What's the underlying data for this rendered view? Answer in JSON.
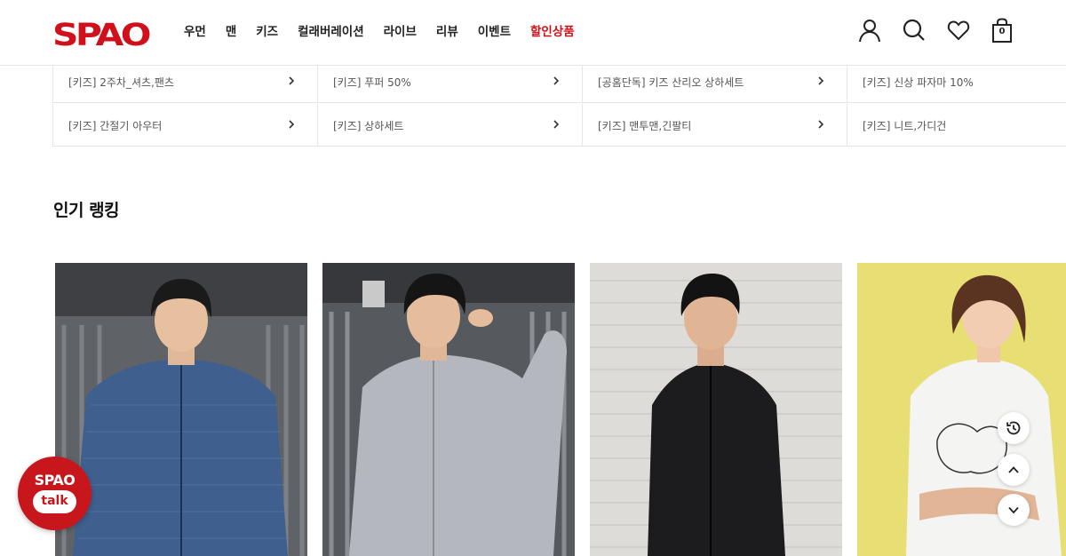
{
  "brand": {
    "logo_text": "SPAO",
    "accent_color": "#d0111b"
  },
  "nav": {
    "items": [
      {
        "label": "우먼",
        "sale": false
      },
      {
        "label": "맨",
        "sale": false
      },
      {
        "label": "키즈",
        "sale": false
      },
      {
        "label": "컬래버레이션",
        "sale": false
      },
      {
        "label": "라이브",
        "sale": false
      },
      {
        "label": "리뷰",
        "sale": false
      },
      {
        "label": "이벤트",
        "sale": false
      },
      {
        "label": "할인상품",
        "sale": true
      }
    ]
  },
  "header_icons": {
    "account": "user-icon",
    "search": "search-icon",
    "wishlist": "heart-icon",
    "cart": "shopping-bag-icon",
    "cart_count": "0"
  },
  "categories": [
    {
      "label": "[키즈] 2주차_셔츠,팬츠"
    },
    {
      "label": "[키즈] 푸퍼 50%"
    },
    {
      "label": "[공홈단독] 키즈 산리오 상하세트"
    },
    {
      "label": "[키즈] 신상 파자마 10%"
    },
    {
      "label": "[키즈] 간절기 아우터"
    },
    {
      "label": "[키즈] 상하세트"
    },
    {
      "label": "[키즈] 맨투맨,긴팔티"
    },
    {
      "label": "[키즈] 니트,가디건"
    }
  ],
  "ranking": {
    "title": "인기 랭킹"
  },
  "spao_talk": {
    "brand": "SPAO",
    "label": "talk"
  },
  "floating_buttons": {
    "recent": "history-icon",
    "top": "arrow-up-icon",
    "bottom": "arrow-down-icon"
  }
}
